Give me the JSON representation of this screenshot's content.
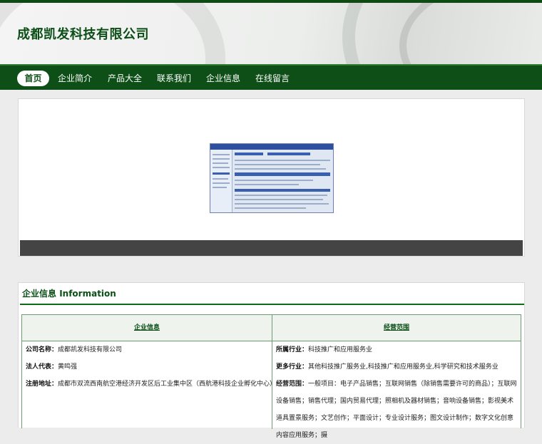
{
  "site": {
    "title": "成都凯发科技有限公司"
  },
  "nav": {
    "items": [
      {
        "label": "首页",
        "active": true
      },
      {
        "label": "企业简介"
      },
      {
        "label": "产品大全"
      },
      {
        "label": "联系我们"
      },
      {
        "label": "企业信息"
      },
      {
        "label": "在线留言"
      }
    ]
  },
  "section": {
    "title": "企业信息",
    "title_en": "Information"
  },
  "table": {
    "left_header": "企业信息",
    "right_header": "经营范围",
    "company_name_label": "公司名称：",
    "company_name": "成都凯发科技有限公司",
    "legal_rep_label": "法人代表：",
    "legal_rep": "黄鸣强",
    "address_label": "注册地址：",
    "address": "成都市双流西南航空港经济开发区后工业集中区（西航港科技企业孵化中心）",
    "industry_label": "所属行业：",
    "industry": "科技推广和应用服务业",
    "more_industry_label": "更多行业：",
    "more_industry": "其他科技推广服务业,科技推广和应用服务业,科学研究和技术服务业",
    "scope_label": "经营范围：",
    "scope": "一般项目：电子产品销售；互联网销售（除销售需要许可的商品）；互联网设备销售；销售代理；国内贸易代理；照相机及器材销售；音响设备销售；影视美术道具置景服务；文艺创作；平面设计；专业设计服务；图文设计制作；数字文化创意内容应用服务；摄"
  },
  "colors": {
    "brand_green": "#0d4f17",
    "title_green": "#0b4e16"
  }
}
